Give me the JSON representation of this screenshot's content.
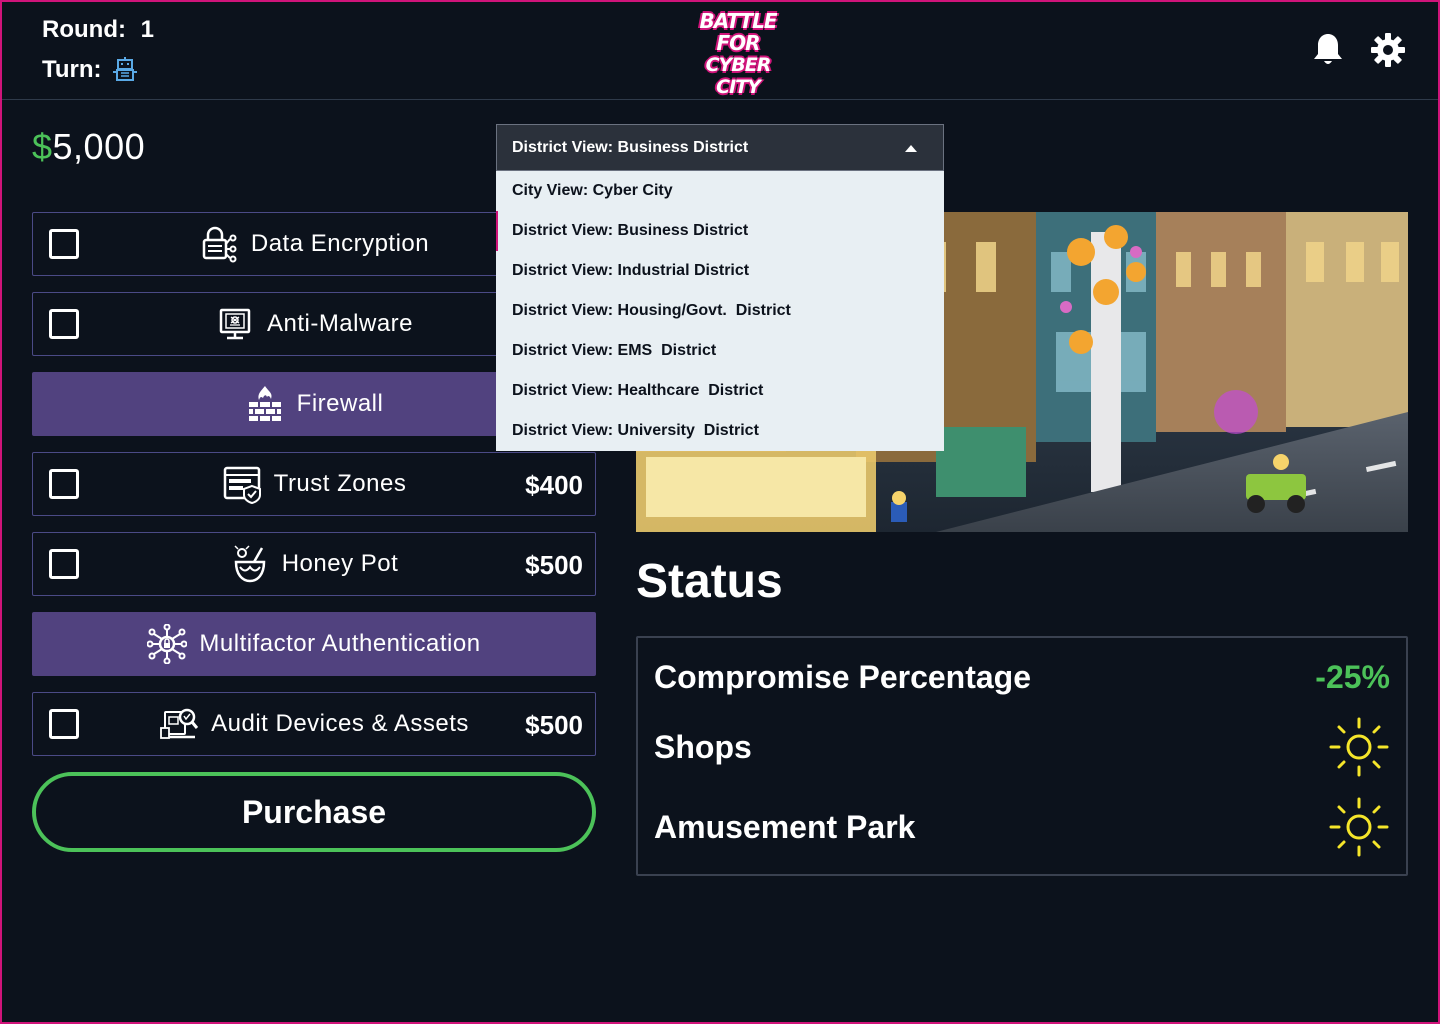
{
  "header": {
    "round_label": "Round:",
    "round_value": "1",
    "turn_label": "Turn:",
    "turn_icon": "robot-icon",
    "logo_lines": [
      "BATTLE",
      "FOR",
      "CYBER CITY"
    ],
    "notification_icon": "bell-icon",
    "settings_icon": "gear-icon"
  },
  "budget": {
    "currency": "$",
    "amount": "5,000"
  },
  "defenses": [
    {
      "label": "Data Encryption",
      "price": "",
      "selected": false,
      "icon": "encryption-lock-icon"
    },
    {
      "label": "Anti-Malware",
      "price": "",
      "selected": false,
      "icon": "anti-malware-monitor-icon"
    },
    {
      "label": "Firewall",
      "price": "",
      "selected": true,
      "icon": "firewall-icon"
    },
    {
      "label": "Trust Zones",
      "price": "$400",
      "selected": false,
      "icon": "trust-zones-icon"
    },
    {
      "label": "Honey Pot",
      "price": "$500",
      "selected": false,
      "icon": "honey-pot-icon"
    },
    {
      "label": "Multifactor Authentication",
      "price": "",
      "selected": true,
      "icon": "multifactor-network-icon"
    },
    {
      "label": "Audit Devices & Assets",
      "price": "$500",
      "selected": false,
      "icon": "audit-devices-icon"
    }
  ],
  "purchase_label": "Purchase",
  "district_select": {
    "current": "District View: Business District",
    "options": [
      "City View: Cyber City",
      "District View: Business District",
      "District View: Industrial District",
      "District View: Housing/Govt.  District",
      "District View: EMS  District",
      "District View: Healthcare  District",
      "District View: University  District"
    ],
    "active_index": 1
  },
  "status": {
    "title": "Status",
    "compromise_label": "Compromise Percentage",
    "compromise_value": "-25%",
    "rows": [
      {
        "label": "Shops",
        "icon": "sun-icon"
      },
      {
        "label": "Amusement Park",
        "icon": "sun-icon"
      }
    ]
  },
  "colors": {
    "background": "#0c121c",
    "accent_green": "#4cc259",
    "accent_purple": "#51427f",
    "accent_magenta": "#d0147a",
    "sun_yellow": "#f5e52a"
  }
}
